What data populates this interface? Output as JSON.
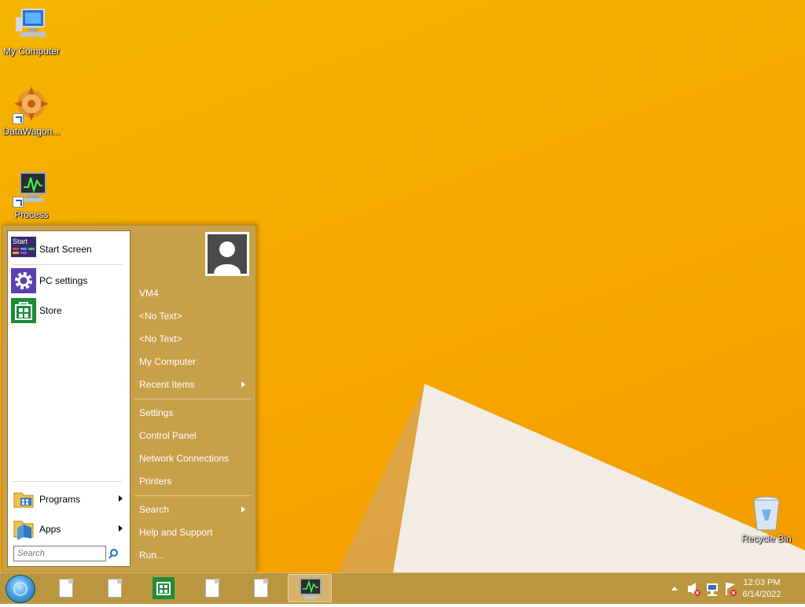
{
  "desktop": {
    "icons": [
      {
        "label": "My Computer"
      },
      {
        "label": "DataWagon..."
      },
      {
        "label": "Process"
      },
      {
        "label": "Recycle Bin"
      }
    ]
  },
  "start_menu": {
    "pinned": [
      {
        "label": "Start Screen",
        "icon": "start-screen-icon"
      },
      {
        "label": "PC settings",
        "icon": "gear-icon"
      },
      {
        "label": "Store",
        "icon": "store-icon"
      }
    ],
    "programs_label": "Programs",
    "apps_label": "Apps",
    "search_placeholder": "Search",
    "right": {
      "user": "VM4",
      "item1": "<No Text>",
      "item2": "<No Text>",
      "my_computer": "My Computer",
      "recent_items": "Recent Items",
      "settings": "Settings",
      "control_panel": "Control Panel",
      "network_connections": "Network Connections",
      "printers": "Printers",
      "search": "Search",
      "help": "Help and Support",
      "run": "Run..."
    }
  },
  "taskbar": {
    "time": "12:03 PM",
    "date": "6/14/2022",
    "buttons": [
      "document",
      "document",
      "store",
      "document",
      "document",
      "process-monitor"
    ]
  },
  "colors": {
    "wallpaper": "#f7ab00",
    "menu": "#c9a04a",
    "taskbar": "#b9963f"
  }
}
